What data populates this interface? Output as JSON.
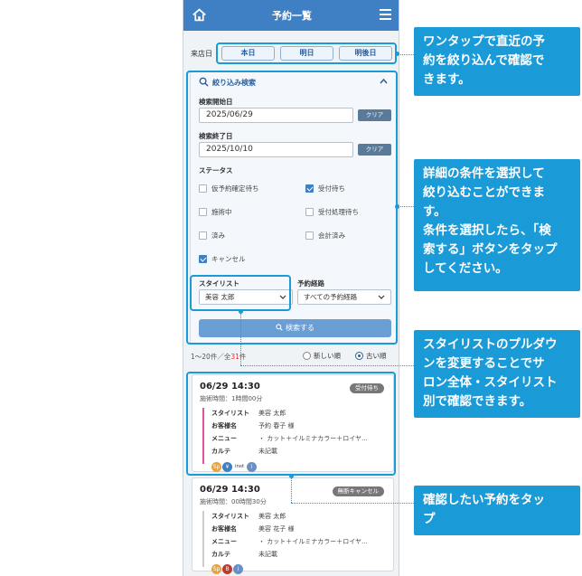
{
  "header": {
    "title": "予約一覧"
  },
  "date_row": {
    "label": "来店日",
    "buttons": [
      "本日",
      "明日",
      "明後日"
    ]
  },
  "filter": {
    "title": "絞り込み検索",
    "start_label": "検索開始日",
    "start_value": "2025/06/29",
    "end_label": "検索終了日",
    "end_value": "2025/10/10",
    "clear_label": "クリア",
    "status_label": "ステータス",
    "statuses": [
      {
        "label": "仮予約確定待ち",
        "checked": false
      },
      {
        "label": "受付待ち",
        "checked": true
      },
      {
        "label": "施術中",
        "checked": false
      },
      {
        "label": "受付処理待ち",
        "checked": false
      },
      {
        "label": "済み",
        "checked": false
      },
      {
        "label": "会計済み",
        "checked": false
      },
      {
        "label": "キャンセル",
        "checked": true
      }
    ],
    "stylist_label": "スタイリスト",
    "stylist_value": "美容 太郎",
    "route_label": "予約経路",
    "route_value": "すべての予約経路",
    "search_label": "検索する"
  },
  "results": {
    "range": "1〜20件／全",
    "total": "31",
    "unit": "件",
    "sort_new": "新しい順",
    "sort_old": "古い順"
  },
  "cards": [
    {
      "datetime": "06/29 14:30",
      "duration": "施術時間：1時間00分",
      "badge": "受付待ち",
      "bar_color": "#e0529c",
      "rows": [
        {
          "k": "スタイリスト",
          "v": "美容 太郎"
        },
        {
          "k": "お客様名",
          "v": "予約 春子 様"
        },
        {
          "k": "メニュー",
          "v": "・ カット＋イルミナカラー＋ロイヤ…"
        },
        {
          "k": "カルテ",
          "v": "未記載"
        }
      ],
      "icons": [
        {
          "name": "sp-icon",
          "label": "Sp",
          "color": "#e8a23a"
        },
        {
          "name": "yen-icon",
          "label": "¥",
          "color": "#3f80c4"
        },
        {
          "name": "inst-icon",
          "label": "inst",
          "color": ""
        },
        {
          "name": "info-icon",
          "label": "i",
          "color": "#6a8fc7"
        }
      ]
    },
    {
      "datetime": "06/29 14:30",
      "duration": "施術時間：00時間30分",
      "badge": "無断キャンセル",
      "bar_color": "#c8cdd2",
      "rows": [
        {
          "k": "スタイリスト",
          "v": "美容 太郎"
        },
        {
          "k": "お客様名",
          "v": "美容 花子 様"
        },
        {
          "k": "メニュー",
          "v": "・ カット＋イルミナカラー＋ロイヤ…"
        },
        {
          "k": "カルテ",
          "v": "未記載"
        }
      ],
      "icons": [
        {
          "name": "sp-icon",
          "label": "Sp",
          "color": "#e8a23a"
        },
        {
          "name": "b-icon",
          "label": "B",
          "color": "#c0392b"
        },
        {
          "name": "info-icon",
          "label": "i",
          "color": "#6a8fc7"
        }
      ]
    }
  ],
  "callouts": [
    "ワンタップで直近の予\n約を絞り込んで確認で\nきます。",
    "詳細の条件を選択して\n絞り込むことができま\nす。\n条件を選択したら、「検\n索する」ボタンをタップ\nしてください。",
    "スタイリストのプルダウ\nンを変更することでサ\nロン全体・スタイリスト\n別で確認できます。",
    "確認したい予約をタッ\nプ"
  ],
  "colors": {
    "accent": "#1a9ad7",
    "header": "#3f80c4"
  }
}
